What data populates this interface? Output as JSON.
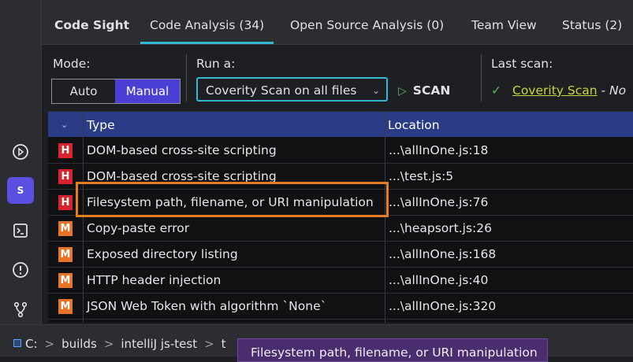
{
  "tabs": [
    {
      "label": "Code Sight"
    },
    {
      "label": "Code Analysis (34)"
    },
    {
      "label": "Open Source Analysis (0)"
    },
    {
      "label": "Team View"
    },
    {
      "label": "Status (2)"
    }
  ],
  "toolbar": {
    "mode_label": "Mode:",
    "mode_auto": "Auto",
    "mode_manual": "Manual",
    "run_label": "Run a:",
    "run_value": "Coverity Scan on all files",
    "scan_label": "SCAN",
    "last_scan_label": "Last scan:",
    "last_scan_link": "Coverity Scan",
    "last_scan_suffix": " - No"
  },
  "table": {
    "col_type": "Type",
    "col_location": "Location",
    "rows": [
      {
        "sev": "H",
        "type": "DOM-based cross-site scripting",
        "location": "...\\allInOne.js:18"
      },
      {
        "sev": "H",
        "type": "DOM-based cross-site scripting",
        "location": "...\\test.js:5"
      },
      {
        "sev": "H",
        "type": "Filesystem path, filename, or URI manipulation",
        "location": "...\\allInOne.js:76"
      },
      {
        "sev": "M",
        "type": "Copy-paste error",
        "location": "...\\heapsort.js:26"
      },
      {
        "sev": "M",
        "type": "Exposed directory listing",
        "location": "...\\allInOne.js:168"
      },
      {
        "sev": "M",
        "type": "HTTP header injection",
        "location": "...\\allInOne.js:40"
      },
      {
        "sev": "M",
        "type": "JSON Web Token with algorithm `None`",
        "location": "...\\allInOne.js:320"
      }
    ]
  },
  "statusbar": {
    "breadcrumb": [
      "C:",
      "builds",
      "intelliJ js-test",
      "t"
    ]
  },
  "tooltip": {
    "text": "Filesystem path, filename, or URI manipulation"
  },
  "colors": {
    "accent": "#35b7d2",
    "header": "#2b3c86",
    "manual_active": "#4b3fd6",
    "severity_high": "#d9232e",
    "severity_medium": "#e7742a",
    "highlight": "#e57c22"
  }
}
